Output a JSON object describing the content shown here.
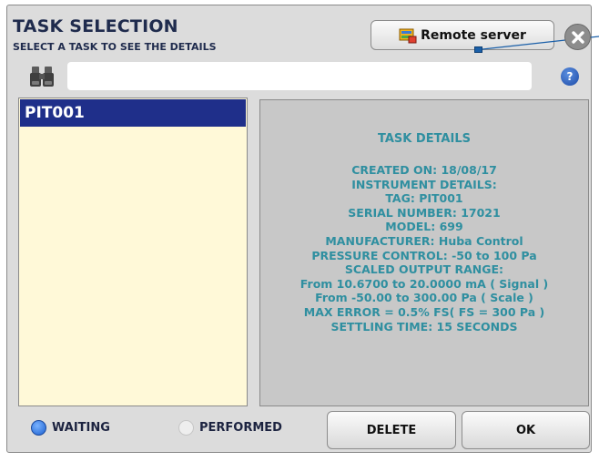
{
  "header": {
    "title": "TASK SELECTION",
    "subtitle": "SELECT A TASK TO SEE THE DETAILS",
    "remote_server_label": "Remote server"
  },
  "search": {
    "value": "",
    "placeholder": ""
  },
  "help_label": "?",
  "tasks": [
    {
      "label": "PIT001",
      "selected": true
    }
  ],
  "details": {
    "heading": "TASK DETAILS",
    "lines": [
      "CREATED ON: 18/08/17",
      "INSTRUMENT DETAILS:",
      "TAG: PIT001",
      "SERIAL NUMBER: 17021",
      "MODEL: 699",
      "MANUFACTURER: Huba Control",
      "PRESSURE CONTROL: -50 to 100 Pa",
      "SCALED OUTPUT RANGE:",
      "From 10.6700 to 20.0000 mA ( Signal )",
      "From -50.00 to 300.00 Pa ( Scale )",
      "MAX ERROR = 0.5% FS( FS = 300 Pa )",
      "SETTLING TIME: 15 SECONDS"
    ]
  },
  "filters": {
    "waiting": {
      "label": "WAITING",
      "selected": true
    },
    "performed": {
      "label": "PERFORMED",
      "selected": false
    }
  },
  "buttons": {
    "delete": "DELETE",
    "ok": "OK"
  },
  "colors": {
    "selection": "#1f2f8a",
    "detail_text": "#2f8fa0",
    "list_background": "#fff9d8",
    "panel_background": "#c8c8c8",
    "frame_background": "#dcdcdc"
  },
  "icons": {
    "remote_server": "server-icon",
    "close": "close-icon",
    "search": "binoculars-icon",
    "help": "help-icon"
  }
}
